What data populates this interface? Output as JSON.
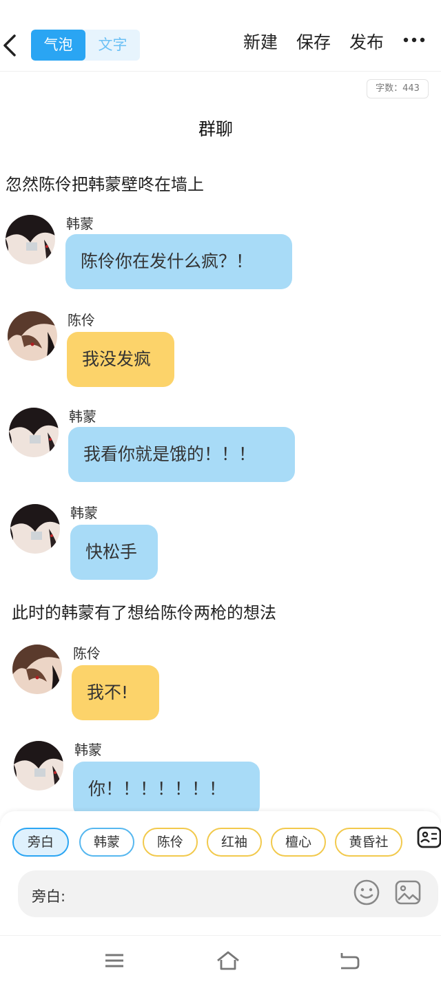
{
  "header": {
    "tab_bubble": "气泡",
    "tab_text": "文字",
    "new_label": "新建",
    "save_label": "保存",
    "publish_label": "发布"
  },
  "word_count": "字数：443",
  "chat_title": "群聊",
  "narrations": [
    "忽然陈伶把韩蒙壁咚在墙上",
    "此时的韩蒙有了想给陈伶两枪的想法"
  ],
  "messages": [
    {
      "speaker": "韩蒙",
      "text": "陈伶你在发什么疯？！"
    },
    {
      "speaker": "陈伶",
      "text": "我没发疯"
    },
    {
      "speaker": "韩蒙",
      "text": "我看你就是饿的！！！"
    },
    {
      "speaker": "韩蒙",
      "text": "快松手"
    },
    {
      "speaker": "陈伶",
      "text": "我不!"
    },
    {
      "speaker": "韩蒙",
      "text": "你！！！！！！！"
    }
  ],
  "roles": [
    "旁白",
    "韩蒙",
    "陈伶",
    "红袖",
    "檀心",
    "黄昏社"
  ],
  "input": {
    "label": "旁白:"
  },
  "colors": {
    "accent": "#2aa5f3",
    "blue_bubble": "#a8dbf7",
    "yellow_bubble": "#fcd36a"
  }
}
